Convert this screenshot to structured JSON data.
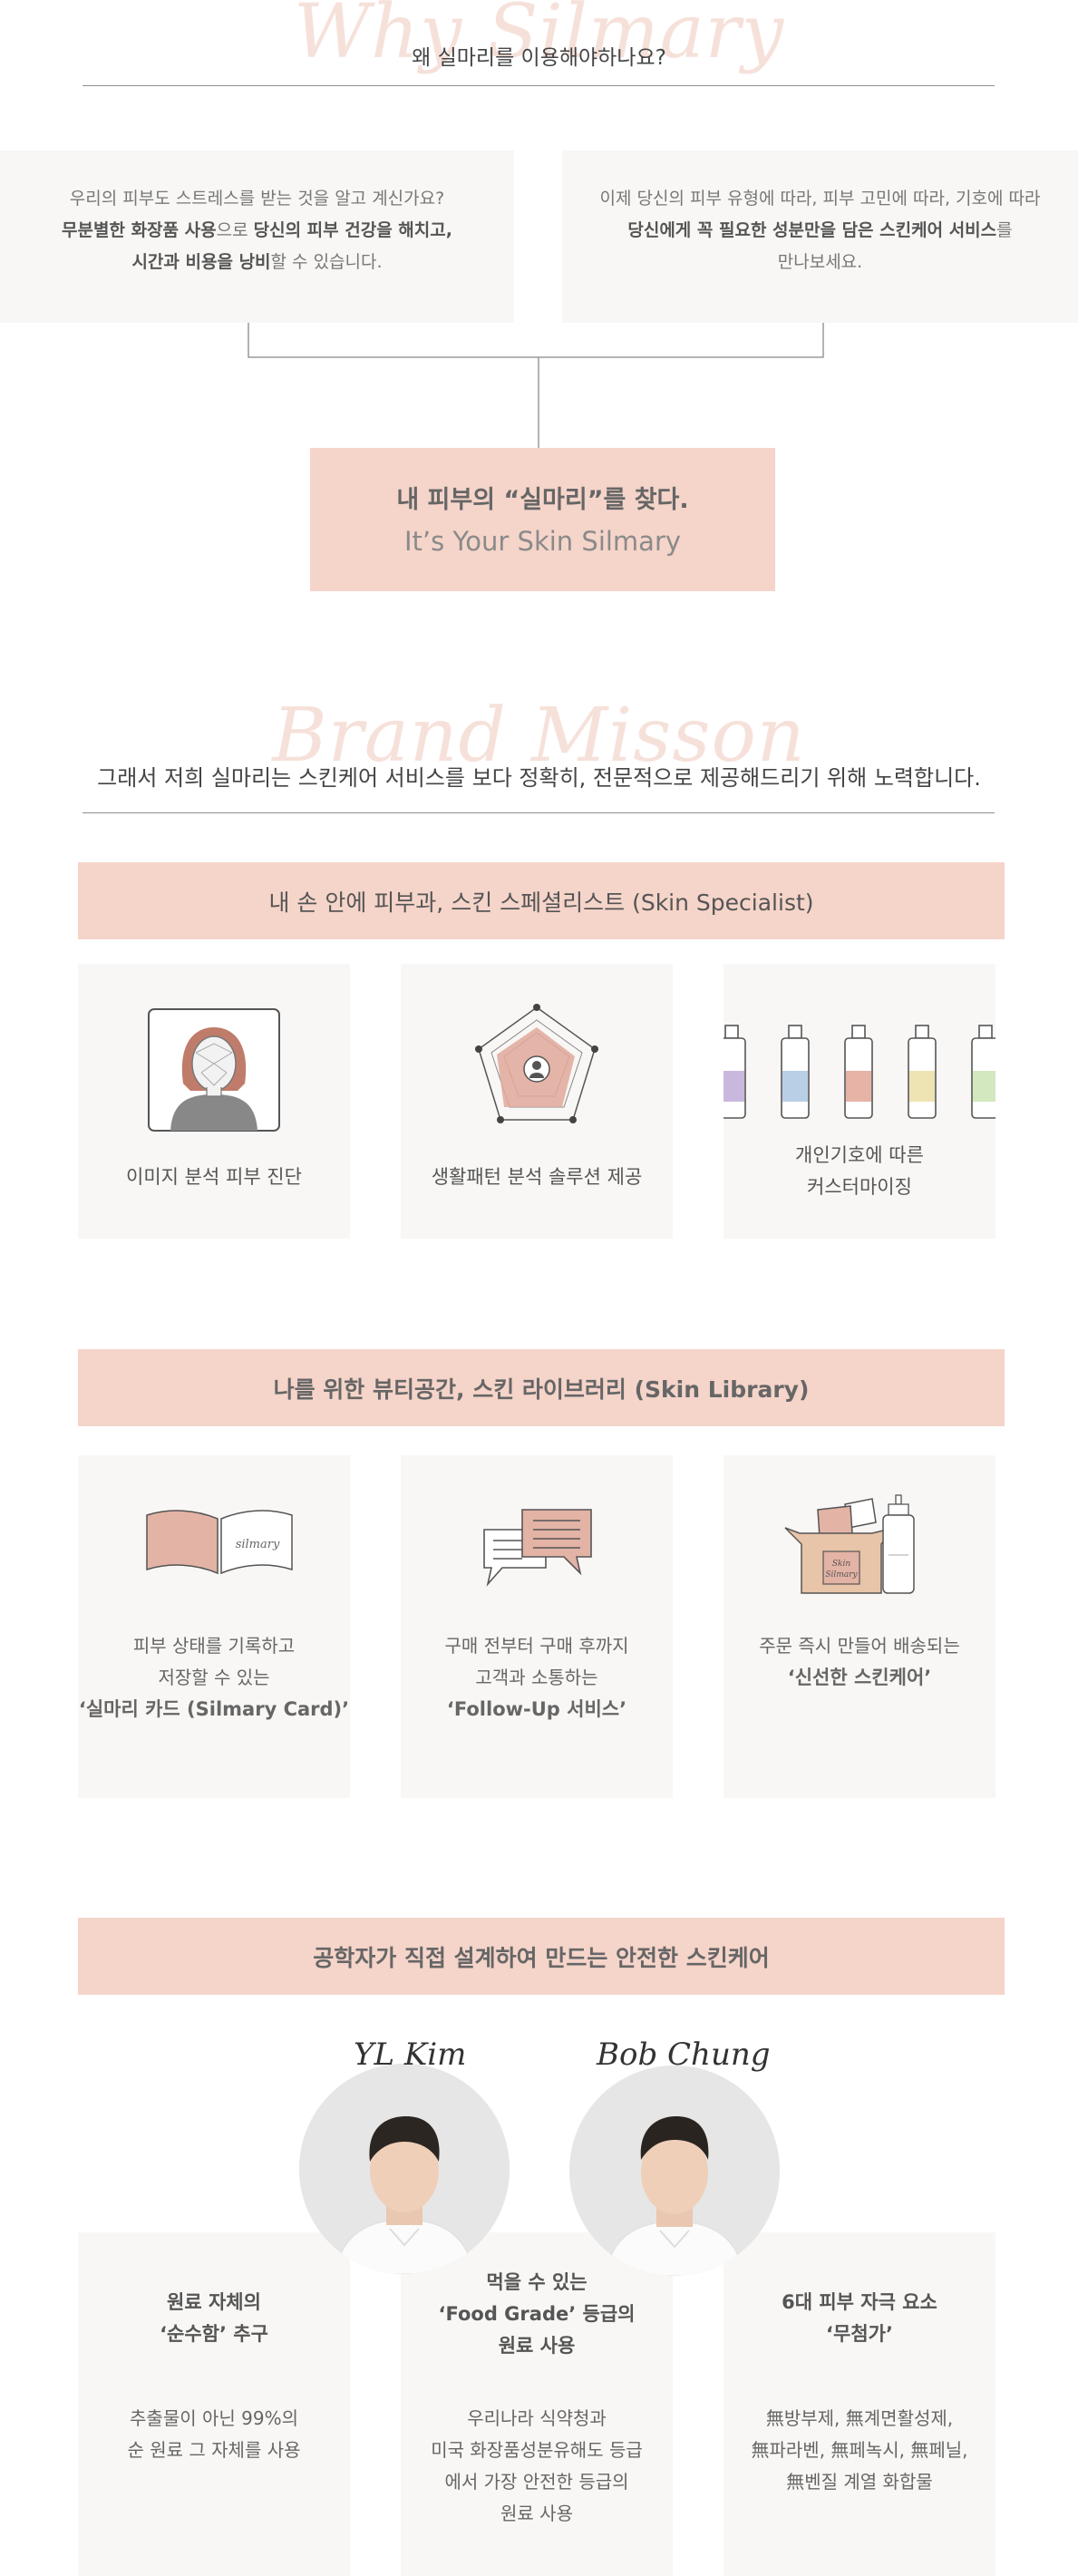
{
  "why": {
    "script_title": "Why Silmary",
    "subtitle": "왜 실마리를 이용해야하나요?",
    "left": {
      "line1": "우리의 피부도 스트레스를 받는 것을 알고 계신가요?",
      "line2_b1": "무분별한 화장품 사용",
      "line2_n1": "으로 ",
      "line2_b2": "당신의 피부 건강을 해치고,",
      "line3_b1": "시간과 비용을 낭비",
      "line3_n1": "할 수 있습니다."
    },
    "right": {
      "line1": "이제 당신의 피부 유형에 따라, 피부 고민에 따라, 기호에 따라",
      "line2_b1": "당신에게 꼭 필요한 성분만을 담은 스킨케어 서비스",
      "line2_n1": "를",
      "line3": "만나보세요."
    },
    "result_kr": "내 피부의 “실마리”를 찾다.",
    "result_en": "It’s Your Skin Silmary"
  },
  "mission": {
    "script_title": "Brand Misson",
    "subtitle": "그래서 저희 실마리는 스킨케어 서비스를 보다 정확히, 전문적으로 제공해드리기 위해 노력합니다."
  },
  "specialist": {
    "banner": "내 손 안에 피부과, 스킨 스페셜리스트 (Skin Specialist)",
    "cards": [
      {
        "title": "이미지 분석 피부 진단"
      },
      {
        "title": "생활패턴 분석 솔루션 제공"
      },
      {
        "title_l1": "개인기호에 따른",
        "title_l2": "커스터마이징"
      }
    ]
  },
  "library": {
    "banner": "나를 위한 뷰티공간, 스킨 라이브러리 (Skin Library)",
    "book_text": "silmary",
    "box_text_1": "Skin",
    "box_text_2": "Silmary",
    "cards": [
      {
        "l1": "피부 상태를 기록하고",
        "l2": "저장할 수 있는",
        "l3": "‘실마리 카드 (Silmary Card)’"
      },
      {
        "l1": "구매 전부터 구매 후까지",
        "l2": "고객과 소통하는",
        "l3": "‘Follow-Up 서비스’"
      },
      {
        "l1": "주문 즉시 만들어 배송되는",
        "l2": "‘신선한 스킨케어’"
      }
    ]
  },
  "engineer": {
    "banner": "공학자가 직접 설계하여 만드는 안전한 스킨케어",
    "people": [
      {
        "signature": "YL Kim"
      },
      {
        "signature": "Bob Chung"
      }
    ],
    "cards": [
      {
        "t1": "원료 자체의",
        "t2": "‘순수함’ 추구",
        "d1": "추출물이 아닌 99%의",
        "d2": "순 원료 그 자체를 사용"
      },
      {
        "t1": "먹을 수 있는",
        "t2": "‘Food Grade’ 등급의",
        "t3": "원료 사용",
        "d1": "우리나라 식약청과",
        "d2": "미국 화장품성분유해도 등급",
        "d3": "에서 가장 안전한 등급의",
        "d4": "원료 사용"
      },
      {
        "t1": "6대 피부 자극 요소",
        "t2": "‘무첨가’",
        "d1": "無방부제, 無계면활성제,",
        "d2": "無파라벤, 無페녹시, 無페닐,",
        "d3": "無벤질 계열 화합물"
      }
    ]
  },
  "colors": {
    "accent_pink": "#f5d4c9",
    "card_gray": "#f8f7f5",
    "script_pink": "#f6e1da"
  }
}
